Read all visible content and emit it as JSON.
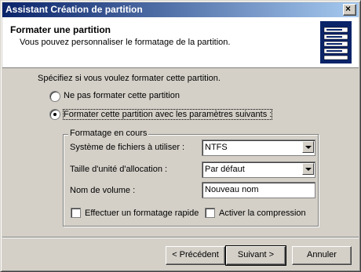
{
  "window": {
    "title": "Assistant Création de partition",
    "close_glyph": "×"
  },
  "header": {
    "title": "Formater une partition",
    "subtitle": "Vous pouvez personnaliser le formatage de la partition.",
    "icon": "disk-stack-icon"
  },
  "prompt": "Spécifiez si vous voulez formater cette partition.",
  "options": {
    "no_format": {
      "label": "Ne pas formater cette partition",
      "selected": false
    },
    "format": {
      "label": "Formater cette partition avec les paramètres suivants :",
      "selected": true
    }
  },
  "group": {
    "title": "Formatage en cours",
    "filesystem_label": "Système de fichiers à utiliser :",
    "filesystem_value": "NTFS",
    "allocation_label": "Taille d'unité d'allocation :",
    "allocation_value": "Par défaut",
    "volume_label": "Nom de volume :",
    "volume_value": "Nouveau nom",
    "quick_format_label": "Effectuer un formatage rapide",
    "quick_format_checked": false,
    "compression_label": "Activer la compression",
    "compression_checked": false
  },
  "buttons": {
    "back": "< Précédent",
    "next": "Suivant >",
    "cancel": "Annuler"
  }
}
